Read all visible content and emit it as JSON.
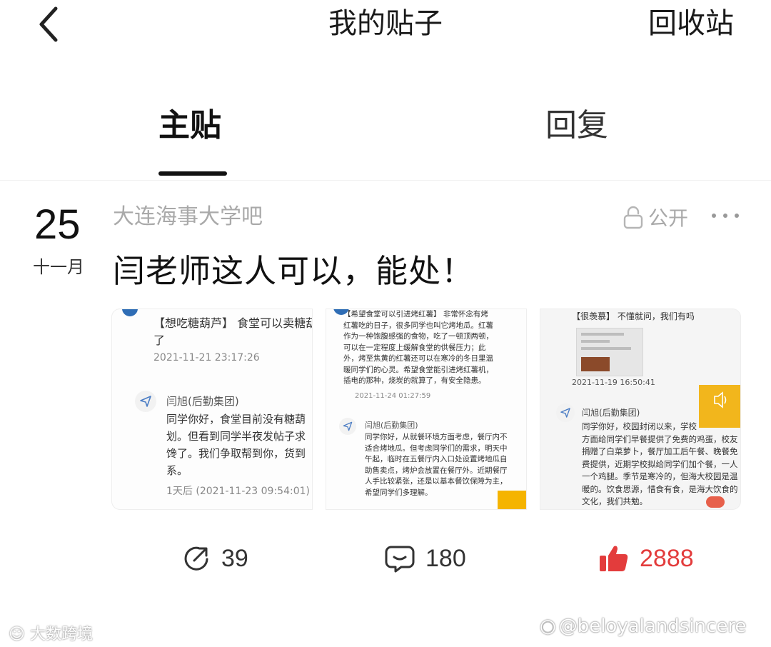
{
  "header": {
    "title": "我的贴子",
    "recycle_bin": "回收站"
  },
  "tabs": [
    {
      "label": "主贴",
      "active": true
    },
    {
      "label": "回复",
      "active": false
    }
  ],
  "post": {
    "day": "25",
    "month": "十一月",
    "forum": "大连海事大学吧",
    "visibility": "公开",
    "title": "闫老师这人可以，能处！",
    "thumbnails": [
      {
        "question": "【想吃糖葫芦】 食堂可以卖糖葫\n了",
        "question_date": "2021-11-21 23:17:26",
        "replier": "闫旭(后勤集团)",
        "answer": "同学你好，食堂目前没有糖葫\n划。但看到同学半夜发帖子求\n馋了。我们争取帮到你，货到\n系。",
        "answer_date": "1天后 (2021-11-23 09:54:01)"
      },
      {
        "question": "【希望食堂可以引进烤红薯】 非常怀念有烤\n红薯吃的日子，很多同学也叫它烤地瓜。红薯\n作为一种饱腹感强的食物，吃了一顿顶两顿，\n可以在一定程度上缓解食堂的供餐压力；此\n外，烤至焦黄的红薯还可以在寒冷的冬日里温\n暖同学们的心灵。希望食堂能引进烤红薯机，\n插电的那种，烧炭的就算了，有安全隐患。",
        "question_date": "2021-11-24 01:27:59",
        "replier": "闫旭(后勤集团)",
        "answer": "同学你好，从就餐环境方面考虑，餐厅内不\n适合烤地瓜。但考虑同学们的需求，明天中\n午起，临时在五餐厅内入口处设置烤地瓜自\n助售卖点，烤炉会放置在餐厅外。近期餐厅\n人手比较紧张，还是以基本餐饮保障为主，\n希望同学们多理解。"
      },
      {
        "question": "【很羡慕】 不懂就问，我们有吗",
        "question_date": "2021-11-19 16:50:41",
        "replier": "闫旭(后勤集团)",
        "answer": "同学你好，校园封闭以来，学校\n方面给同学们早餐提供了免费的鸡蛋，校友\n捐赠了白菜萝卜，餐厅加工后午餐、晚餐免\n费提供，近期学校拟给同学们加个餐，一人\n一个鸡腿。季节是寒冷的，但海大校园是温\n暖的。饮食思源，惜食有食，是海大饮食的\n文化，我们共勉。"
      }
    ],
    "stats": {
      "shares": "39",
      "comments": "180",
      "likes": "2888"
    }
  },
  "watermarks": {
    "left": "大数跨境",
    "right": "@beloyalandsincere"
  },
  "colors": {
    "like_red": "#e33c3c",
    "muted_gray": "#a9a9a9",
    "accent_orange": "#f5b400"
  }
}
